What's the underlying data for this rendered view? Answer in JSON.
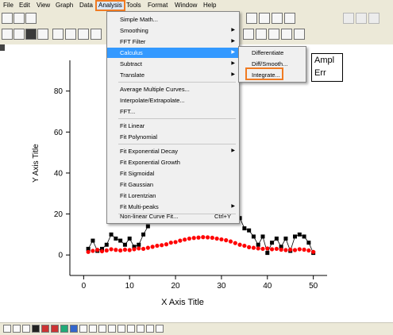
{
  "menubar": {
    "items": [
      {
        "label": "File"
      },
      {
        "label": "Edit"
      },
      {
        "label": "View"
      },
      {
        "label": "Graph"
      },
      {
        "label": "Data"
      },
      {
        "label": "Analysis"
      },
      {
        "label": "Tools"
      },
      {
        "label": "Format"
      },
      {
        "label": "Window"
      },
      {
        "label": "Help"
      }
    ]
  },
  "analysis_menu": {
    "items": [
      {
        "label": "Simple Math...",
        "submenu": false
      },
      {
        "label": "Smoothing",
        "submenu": true
      },
      {
        "label": "FFT Filter",
        "submenu": true
      },
      {
        "label": "Calculus",
        "submenu": true,
        "highlighted": true
      },
      {
        "label": "Subtract",
        "submenu": true
      },
      {
        "label": "Translate",
        "submenu": true
      },
      {
        "label": "Average Multiple Curves...",
        "submenu": false
      },
      {
        "label": "Interpolate/Extrapolate...",
        "submenu": false
      },
      {
        "label": "FFT...",
        "submenu": false
      },
      {
        "label": "Fit Linear",
        "submenu": false
      },
      {
        "label": "Fit Polynomial",
        "submenu": false
      },
      {
        "label": "Fit Exponential Decay",
        "submenu": true
      },
      {
        "label": "Fit Exponential Growth",
        "submenu": false
      },
      {
        "label": "Fit Sigmoidal",
        "submenu": false
      },
      {
        "label": "Fit Gaussian",
        "submenu": false
      },
      {
        "label": "Fit Lorentzian",
        "submenu": false
      },
      {
        "label": "Fit Multi-peaks",
        "submenu": true
      },
      {
        "label": "Non-linear Curve Fit...",
        "submenu": false,
        "shortcut": "Ctrl+Y"
      }
    ]
  },
  "calculus_submenu": {
    "items": [
      {
        "label": "Differentiate"
      },
      {
        "label": "Diff/Smooth..."
      },
      {
        "label": "Integrate..."
      }
    ]
  },
  "legend": {
    "line1": "Ampl",
    "line2": "Err"
  },
  "colors": {
    "accent": "#f07b22",
    "highlight": "#3399ff",
    "series_black": "#000000",
    "series_red": "#ff0000"
  },
  "chart_data": {
    "type": "scatter",
    "xlabel": "X Axis Title",
    "ylabel": "Y Axis Title",
    "xlim": [
      -3,
      53
    ],
    "ylim": [
      -10,
      95
    ],
    "xticks": [
      0,
      10,
      20,
      30,
      40,
      50
    ],
    "yticks": [
      0,
      20,
      40,
      60,
      80
    ],
    "series": [
      {
        "color": "#000000",
        "marker": "square-line",
        "x": [
          1,
          2,
          3,
          4,
          5,
          6,
          7,
          8,
          9,
          10,
          11,
          12,
          13,
          14,
          34,
          35,
          36,
          37,
          38,
          39,
          40,
          41,
          42,
          43,
          44,
          45,
          46,
          47,
          48,
          49,
          50
        ],
        "y": [
          3,
          7,
          2,
          3,
          5,
          10,
          8,
          7,
          5,
          8,
          4,
          5,
          10,
          14,
          18,
          13,
          12,
          9,
          5,
          9,
          1,
          6,
          8,
          4,
          8,
          2,
          9,
          10,
          9,
          6,
          1
        ]
      },
      {
        "color": "#ff0000",
        "marker": "circle",
        "x": [
          1,
          2,
          3,
          4,
          5,
          6,
          7,
          8,
          9,
          10,
          11,
          12,
          13,
          14,
          15,
          16,
          17,
          18,
          19,
          20,
          21,
          22,
          23,
          24,
          25,
          26,
          27,
          28,
          29,
          30,
          31,
          32,
          33,
          34,
          35,
          36,
          37,
          38,
          39,
          40,
          41,
          42,
          43,
          44,
          45,
          46,
          47,
          48,
          49,
          50
        ],
        "y": [
          1.5,
          2,
          2.5,
          1.8,
          2.2,
          2.8,
          2.5,
          2.2,
          2.6,
          2.4,
          2.8,
          3.2,
          3,
          3.5,
          4,
          4.5,
          4.8,
          5.2,
          6,
          6.3,
          7,
          7.5,
          8,
          8.3,
          8.5,
          8.7,
          8.6,
          8.4,
          8,
          7.6,
          7.2,
          6.6,
          5.8,
          5,
          4.5,
          3.8,
          3.5,
          3.2,
          3,
          3.2,
          2.8,
          3,
          2.6,
          2.4,
          2.6,
          2.4,
          2.8,
          2.6,
          2.2,
          1.5
        ]
      }
    ]
  }
}
